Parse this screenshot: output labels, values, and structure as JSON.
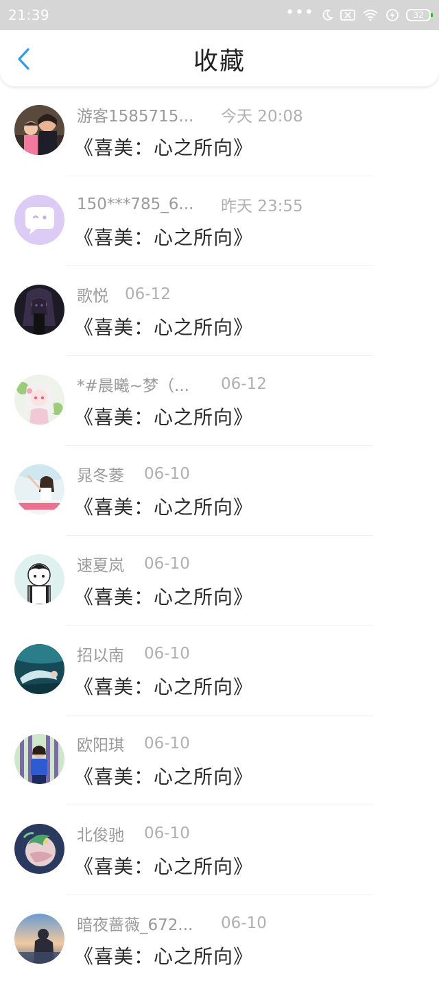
{
  "status_bar": {
    "time": "21:39",
    "battery": "32",
    "icons": [
      "more-dots-icon",
      "moon-icon",
      "sim-off-icon",
      "wifi-icon",
      "charging-icon",
      "battery-icon"
    ]
  },
  "header": {
    "title": "收藏",
    "back_icon": "chevron-left-icon",
    "accent_color": "#2a9ee8"
  },
  "favorites": [
    {
      "name": "游客1585715...",
      "time": "今天 20:08",
      "title": "《喜美：心之所向》",
      "avatar": "photo-grandma-child"
    },
    {
      "name": "150***785_6...",
      "time": "昨天 23:55",
      "title": "《喜美：心之所向》",
      "avatar": "purple-chat-bubble"
    },
    {
      "name": "歌悦",
      "time": "06-12",
      "title": "《喜美：心之所向》",
      "avatar": "dark-anime-girl"
    },
    {
      "name": "*#晨曦~梦（...",
      "time": "06-12",
      "title": "《喜美：心之所向》",
      "avatar": "anime-girl-flowers"
    },
    {
      "name": "晁冬菱",
      "time": "06-10",
      "title": "《喜美：心之所向》",
      "avatar": "girl-pink-text"
    },
    {
      "name": "速夏岚",
      "time": "06-10",
      "title": "《喜美：心之所向》",
      "avatar": "cartoon-boy"
    },
    {
      "name": "招以南",
      "time": "06-10",
      "title": "《喜美：心之所向》",
      "avatar": "underwater-swimmer"
    },
    {
      "name": "欧阳琪",
      "time": "06-10",
      "title": "《喜美：心之所向》",
      "avatar": "girl-blue-jacket"
    },
    {
      "name": "北俊驰",
      "time": "06-10",
      "title": "《喜美：心之所向》",
      "avatar": "dragon-art"
    },
    {
      "name": "暗夜蔷薇_672...",
      "time": "06-10",
      "title": "《喜美：心之所向》",
      "avatar": "person-sunset"
    }
  ]
}
